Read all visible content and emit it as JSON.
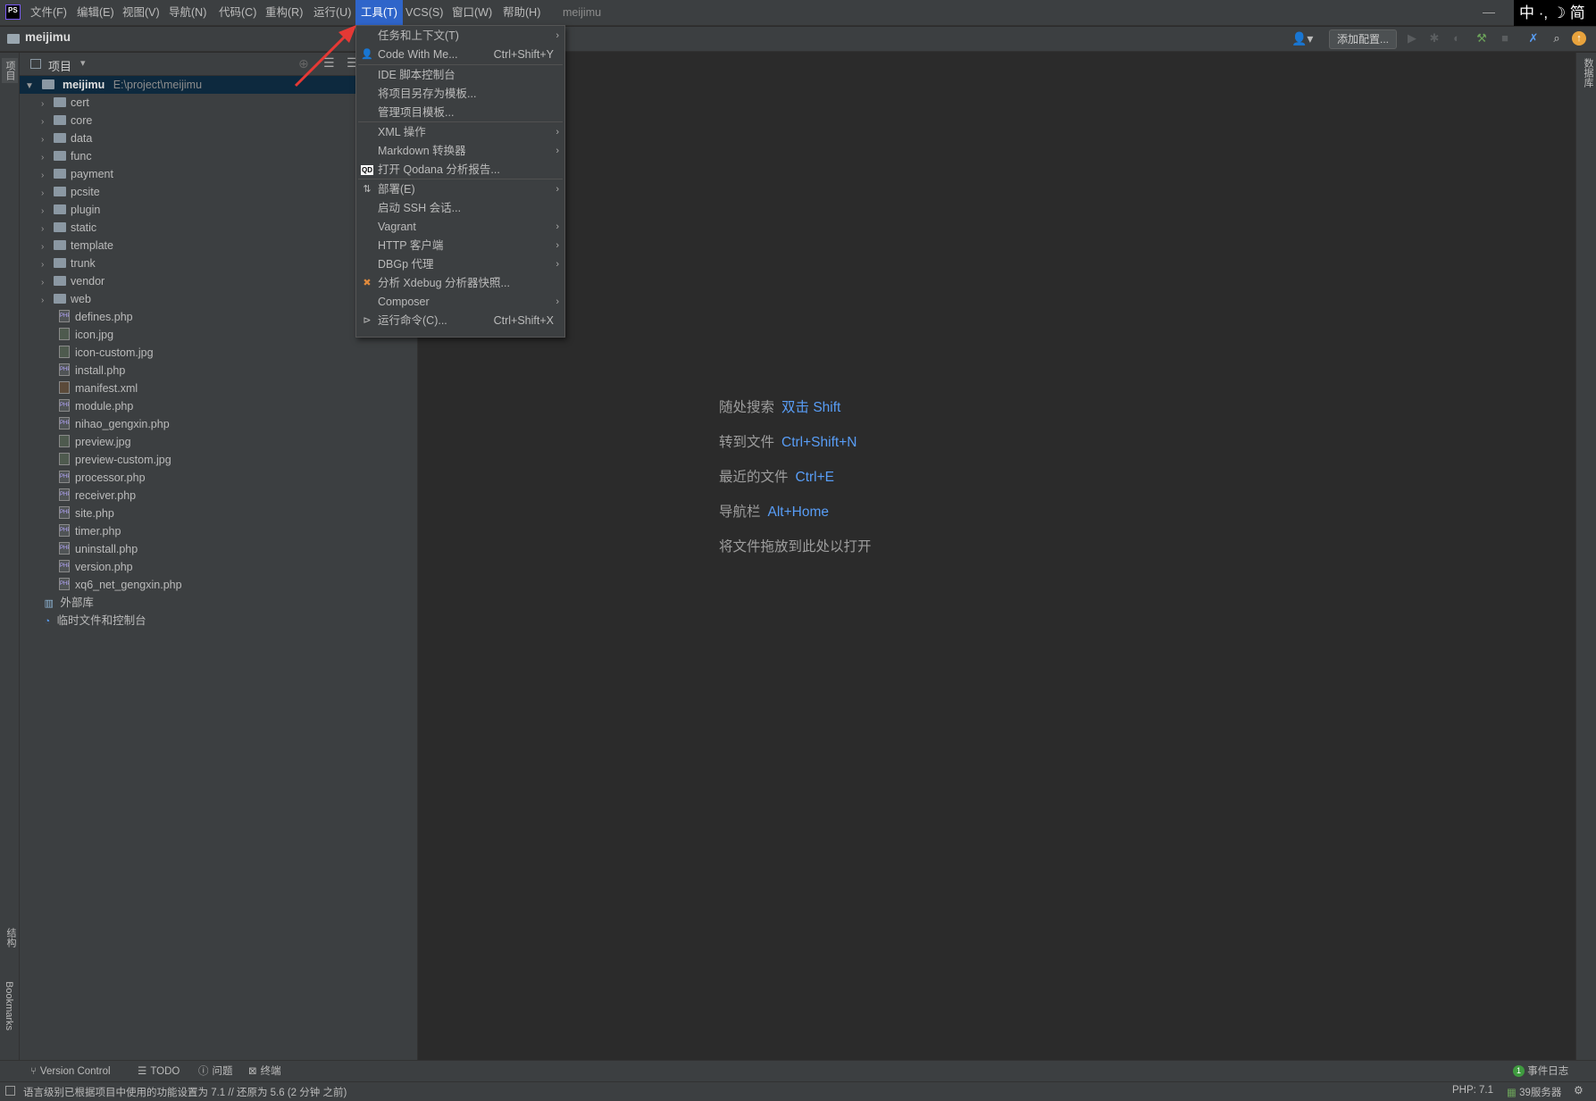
{
  "menubar": {
    "logo": "PS",
    "items": [
      "文件(F)",
      "编辑(E)",
      "视图(V)",
      "导航(N)",
      "代码(C)",
      "重构(R)",
      "运行(U)",
      "工具(T)",
      "VCS(S)",
      "窗口(W)",
      "帮助(H)"
    ],
    "window_title": "meijimu",
    "minimize": "—",
    "ime": "中 ·, ☽ 简"
  },
  "navbar": {
    "project": "meijimu",
    "user_icon": "👤▾",
    "add_config": "添加配置..."
  },
  "left_strip": {
    "project": "项目",
    "structure": "结构",
    "bookmarks": "Bookmarks"
  },
  "right_strip": {
    "database": "数据库"
  },
  "project_panel": {
    "header": "项目",
    "header_arrow": "▾",
    "root_name": "meijimu",
    "root_path": "E:\\project\\meijimu",
    "folders": [
      "cert",
      "core",
      "data",
      "func",
      "payment",
      "pcsite",
      "plugin",
      "static",
      "template",
      "trunk",
      "vendor",
      "web"
    ],
    "files": [
      "defines.php",
      "icon.jpg",
      "icon-custom.jpg",
      "install.php",
      "manifest.xml",
      "module.php",
      "nihao_gengxin.php",
      "preview.jpg",
      "preview-custom.jpg",
      "processor.php",
      "receiver.php",
      "site.php",
      "timer.php",
      "uninstall.php",
      "version.php",
      "xq6_net_gengxin.php"
    ],
    "external_libs": "外部库",
    "scratches": "临时文件和控制台"
  },
  "tools_menu": {
    "items": [
      {
        "label": "任务和上下文(T)",
        "submenu": true
      },
      {
        "label": "Code With Me...",
        "shortcut": "Ctrl+Shift+Y"
      },
      {
        "label": "IDE 脚本控制台"
      },
      {
        "label": "将项目另存为模板..."
      },
      {
        "label": "管理项目模板..."
      },
      {
        "label": "XML 操作",
        "submenu": true
      },
      {
        "label": "Markdown 转换器",
        "submenu": true
      },
      {
        "label": "打开 Qodana 分析报告..."
      },
      {
        "label": "部署(E)",
        "submenu": true
      },
      {
        "label": "启动 SSH 会话..."
      },
      {
        "label": "Vagrant",
        "submenu": true
      },
      {
        "label": "HTTP 客户端",
        "submenu": true
      },
      {
        "label": "DBGp 代理",
        "submenu": true
      },
      {
        "label": "分析 Xdebug 分析器快照..."
      },
      {
        "label": "Composer",
        "submenu": true
      },
      {
        "label": "运行命令(C)...",
        "shortcut": "Ctrl+Shift+X"
      }
    ]
  },
  "editor_hints": [
    {
      "label": "随处搜索",
      "key": "双击 Shift"
    },
    {
      "label": "转到文件",
      "key": "Ctrl+Shift+N"
    },
    {
      "label": "最近的文件",
      "key": "Ctrl+E"
    },
    {
      "label": "导航栏",
      "key": "Alt+Home"
    },
    {
      "label": "将文件拖放到此处以打开",
      "key": ""
    }
  ],
  "bottom_tabs": [
    "Version Control",
    "TODO",
    "问题",
    "终端"
  ],
  "event_log": {
    "count": "1",
    "label": "事件日志"
  },
  "statusbar": {
    "message": "语言级别已根据项目中使用的功能设置为 7.1 // 还原为 5.6 (2 分钟 之前)",
    "php": "PHP: 7.1",
    "server": "39服务器"
  },
  "colors": {
    "accent": "#2f65ca",
    "link": "#589df6",
    "selection": "#0d293e"
  }
}
